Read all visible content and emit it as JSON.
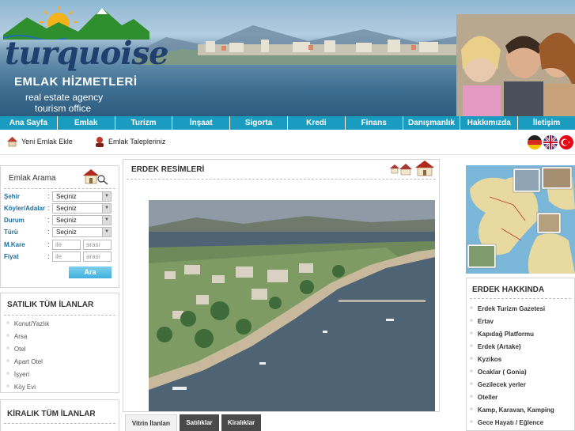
{
  "header": {
    "logo_text": "turquoise",
    "logo_sub": "EMLAK HİZMETLERİ",
    "tagline_1": "real estate agency",
    "tagline_2": "tourism office"
  },
  "nav": {
    "items": [
      "Ana Sayfa",
      "Emlak",
      "Turizm",
      "İnşaat",
      "Sigorta",
      "Kredi",
      "Finans",
      "Danışmanlık",
      "Hakkımızda",
      "İletişim"
    ]
  },
  "subbar": {
    "add_listing": "Yeni Emlak Ekle",
    "requests": "Emlak Talepleriniz"
  },
  "search": {
    "title": "Emlak Arama",
    "fields": [
      {
        "label": "Şehir",
        "value": "Seçiniz"
      },
      {
        "label": "Köyler/Adalar",
        "value": "Seçiniz"
      },
      {
        "label": "Durum",
        "value": "Seçiniz"
      },
      {
        "label": "Türü",
        "value": "Seçiniz"
      }
    ],
    "mkare_label": "M.Kare",
    "fiyat_label": "Fiyat",
    "from_placeholder": "ile",
    "to_placeholder": "arası",
    "button": "Ara"
  },
  "satilik": {
    "title": "SATILIK TÜM İLANLAR",
    "items": [
      "Konut/Yazlık",
      "Arsa",
      "Otel",
      "Apart Otel",
      "İşyeri",
      "Köy Evi"
    ]
  },
  "kiralik": {
    "title": "KİRALIK TÜM İLANLAR"
  },
  "main": {
    "title": "ERDEK RESİMLERİ"
  },
  "tabs": [
    "Vitrin İlanları",
    "Satılıklar",
    "Kiralıklar"
  ],
  "hakkinda": {
    "title": "ERDEK HAKKINDA",
    "items": [
      "Erdek Turizm Gazetesi",
      "Ertav",
      "Kapıdağ Platformu",
      "Erdek (Artake)",
      "Kyzikos",
      "Ocaklar ( Gonia)",
      "Gezilecek yerler",
      "Oteller",
      "Kamp, Karavan, Kamping",
      "Gece Hayatı / Eğlence"
    ]
  },
  "colors": {
    "nav_bg": "#1a9cc0",
    "label_blue": "#1a6fa0"
  }
}
